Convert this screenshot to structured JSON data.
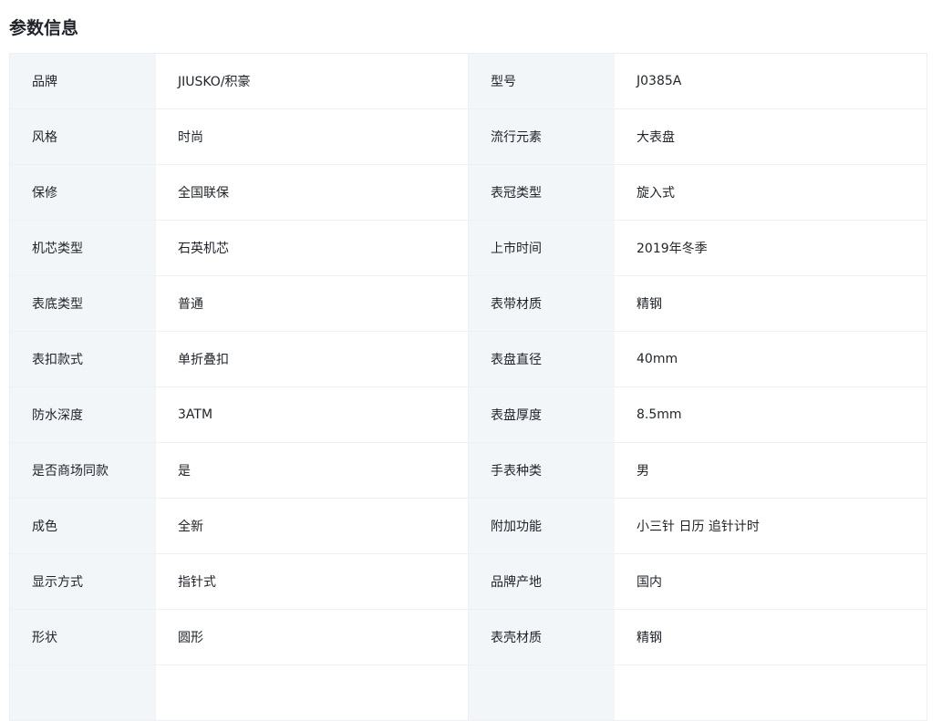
{
  "section": {
    "title": "参数信息"
  },
  "params": {
    "rows": [
      {
        "l1": "品牌",
        "v1": "JIUSKO/积豪",
        "l2": "型号",
        "v2": "J0385A"
      },
      {
        "l1": "风格",
        "v1": "时尚",
        "l2": "流行元素",
        "v2": "大表盘"
      },
      {
        "l1": "保修",
        "v1": "全国联保",
        "l2": "表冠类型",
        "v2": "旋入式"
      },
      {
        "l1": "机芯类型",
        "v1": "石英机芯",
        "l2": "上市时间",
        "v2": "2019年冬季"
      },
      {
        "l1": "表底类型",
        "v1": "普通",
        "l2": "表带材质",
        "v2": "精钢"
      },
      {
        "l1": "表扣款式",
        "v1": "单折叠扣",
        "l2": "表盘直径",
        "v2": "40mm"
      },
      {
        "l1": "防水深度",
        "v1": "3ATM",
        "l2": "表盘厚度",
        "v2": "8.5mm"
      },
      {
        "l1": "是否商场同款",
        "v1": "是",
        "l2": "手表种类",
        "v2": "男"
      },
      {
        "l1": "成色",
        "v1": "全新",
        "l2": "附加功能",
        "v2": "小三针 日历 追针计时"
      },
      {
        "l1": "显示方式",
        "v1": "指针式",
        "l2": "品牌产地",
        "v2": "国内"
      },
      {
        "l1": "形状",
        "v1": "圆形",
        "l2": "表壳材质",
        "v2": "精钢"
      }
    ]
  }
}
